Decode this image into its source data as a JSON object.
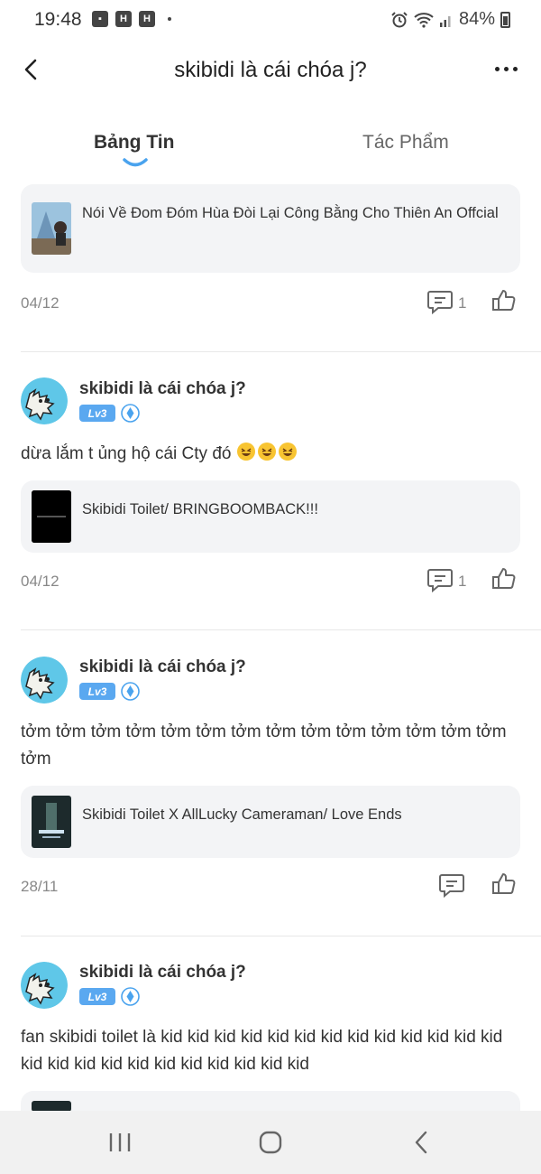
{
  "status_bar": {
    "time": "19:48",
    "battery": "84%",
    "notif_icons": [
      "H",
      "H"
    ]
  },
  "header": {
    "title": "skibidi là cái chóa j?"
  },
  "tabs": [
    {
      "label": "Bảng Tin",
      "active": true
    },
    {
      "label": "Tác Phẩm",
      "active": false
    }
  ],
  "posts": [
    {
      "card_title": "Nói Về Đom Đóm Hùa Đòi Lại Công Bằng Cho Thiên An Offcial",
      "date": "04/12",
      "comment_count": "1"
    },
    {
      "author": "skibidi là cái chóa j?",
      "level": "Lv3",
      "text": "dừa lắm t ủng hộ cái Cty đó",
      "card_title": "Skibidi Toilet/ BRINGBOOMBACK!!!",
      "date": "04/12",
      "comment_count": "1"
    },
    {
      "author": "skibidi là cái chóa j?",
      "level": "Lv3",
      "text": "tởm tởm tởm tởm tởm tởm tởm tởm tởm tởm tởm tởm tởm tởm tởm",
      "card_title": "Skibidi Toilet X AllLucky Cameraman/ Love Ends",
      "date": "28/11",
      "comment_count": ""
    },
    {
      "author": "skibidi là cái chóa j?",
      "level": "Lv3",
      "text": "fan skibidi toilet là kid kid kid kid kid kid kid kid kid kid kid kid kid kid kid kid kid kid kid kid kid kid kid kid"
    }
  ],
  "colors": {
    "accent": "#4aa3ee",
    "card_bg": "#f3f4f6",
    "level_badge": "#5aa8f0"
  },
  "icons": {
    "back": "chevron-left-icon",
    "more": "more-dots-icon",
    "comment": "comment-icon",
    "like": "thumbs-up-icon",
    "verify": "verified-icon",
    "nav": [
      "recent-apps-icon",
      "home-icon",
      "back-icon"
    ]
  }
}
